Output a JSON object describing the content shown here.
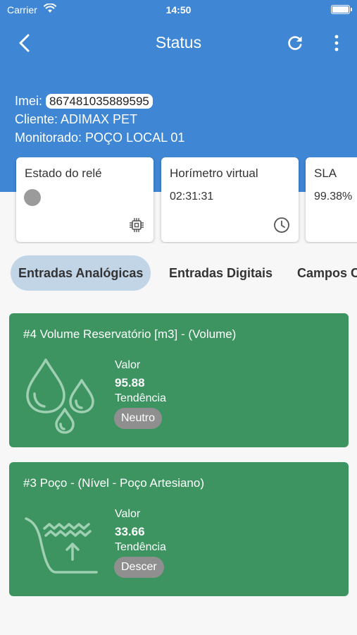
{
  "status_bar": {
    "carrier": "Carrier",
    "time": "14:50"
  },
  "nav": {
    "title": "Status"
  },
  "info": {
    "imei_label": "Imei:",
    "imei_value": "867481035889595",
    "client_line": "Cliente: ADIMAX PET",
    "monitored_line": "Monitorado: POÇO LOCAL 01"
  },
  "summary_cards": [
    {
      "title": "Estado do relé",
      "icon": "chip-icon",
      "status_color": "#9b9b9b"
    },
    {
      "title": "Horímetro virtual",
      "value": "02:31:31",
      "icon": "clock-icon"
    },
    {
      "title": "SLA",
      "value": "99.38%"
    }
  ],
  "tabs": [
    {
      "label": "Entradas Analógicas",
      "active": true
    },
    {
      "label": "Entradas Digitais",
      "active": false
    },
    {
      "label": "Campos Calculados",
      "active": false
    }
  ],
  "inputs": [
    {
      "title": "#4 Volume Reservatório [m3] - (Volume)",
      "icon": "water-drops-icon",
      "value_label": "Valor",
      "value": "95.88",
      "trend_label": "Tendência",
      "trend": "Neutro"
    },
    {
      "title": "#3 Poço - (Nível - Poço Artesiano)",
      "icon": "well-level-icon",
      "value_label": "Valor",
      "value": "33.66",
      "trend_label": "Tendência",
      "trend": "Descer"
    }
  ],
  "colors": {
    "header": "#3f87d4",
    "card_green": "#3d9461",
    "tab_active": "#c1d5e7",
    "pill": "#8f8f8f"
  }
}
